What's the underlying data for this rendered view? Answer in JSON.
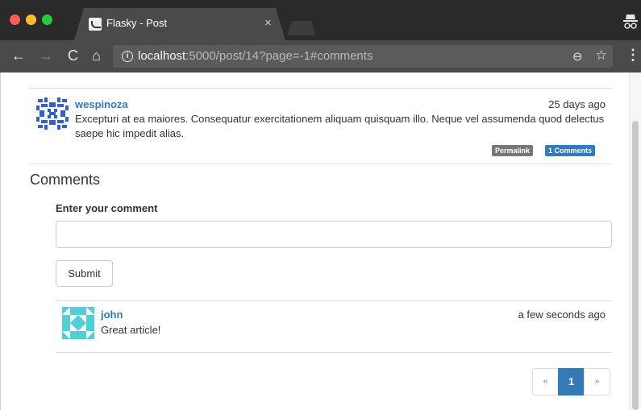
{
  "browser": {
    "tab_title": "Flasky - Post",
    "tab_close": "×",
    "url_host": "localhost",
    "url_rest": ":5000/post/14?page=-1#comments",
    "nav": {
      "back": "←",
      "forward": "→",
      "reload": "C",
      "home": "⌂"
    },
    "icons": {
      "info": "i",
      "zoom": "⊖",
      "star": "☆",
      "menu": "⋮"
    }
  },
  "post": {
    "author": "wespinoza",
    "date": "25 days ago",
    "body": "Excepturi at ea maiores. Consequatur exercitationem aliquam quisquam illo. Neque vel assumenda quod delectus saepe hic impedit alias.",
    "permalink_label": "Permalink",
    "comments_label": "1 Comments",
    "avatar_color": "#2f5fd6"
  },
  "comments_section": {
    "heading": "Comments",
    "form_label": "Enter your comment",
    "input_value": "",
    "submit_label": "Submit"
  },
  "comments": [
    {
      "author": "john",
      "date": "a few seconds ago",
      "body": "Great article!",
      "avatar_color": "#4fcfd6"
    }
  ],
  "pagination": {
    "prev": "«",
    "current": "1",
    "next": "»"
  },
  "colors": {
    "link": "#337ab7",
    "label_default": "#777777",
    "chrome_dark": "#4a4a4a"
  }
}
